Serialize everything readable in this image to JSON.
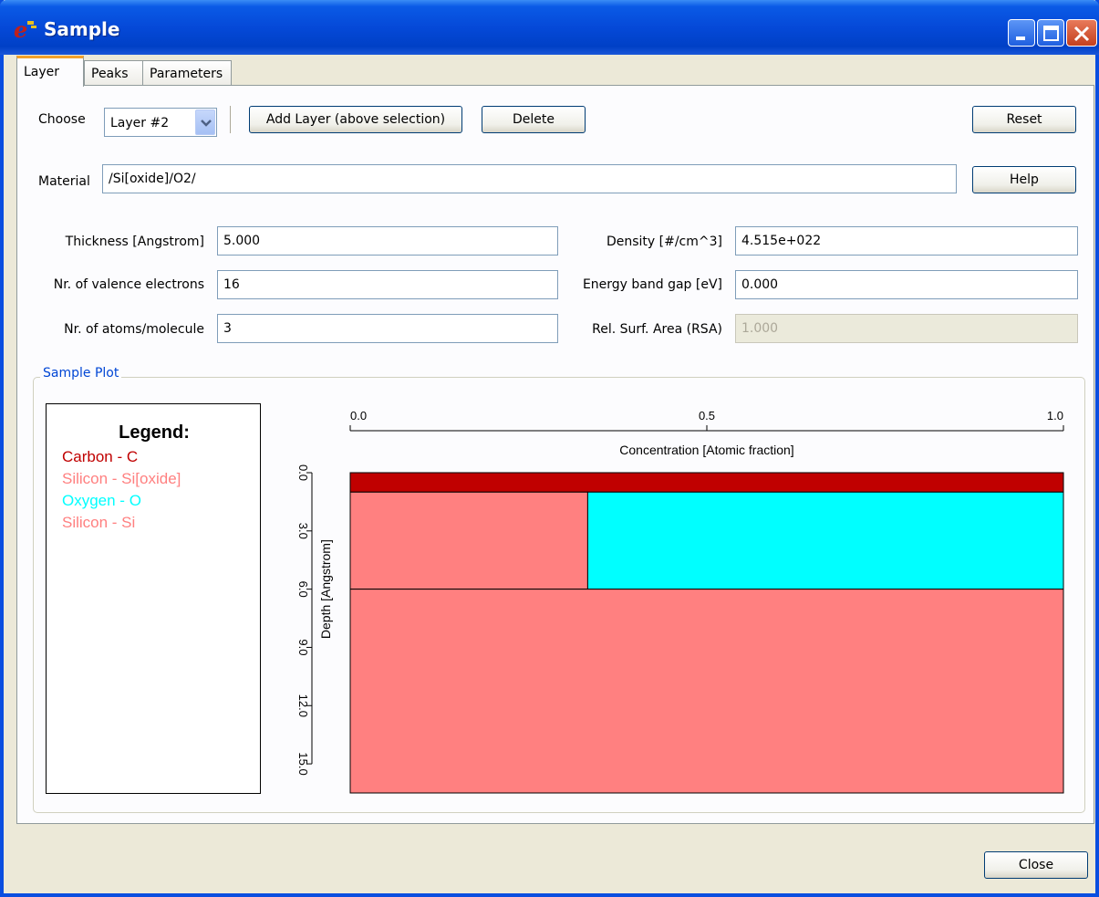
{
  "window": {
    "title": "Sample"
  },
  "tabs": [
    {
      "label": "Layer",
      "active": true
    },
    {
      "label": "Peaks",
      "active": false
    },
    {
      "label": "Parameters",
      "active": false
    }
  ],
  "layer": {
    "choose_label": "Choose",
    "layer_select_value": "Layer #2",
    "add_layer_label": "Add Layer (above selection)",
    "delete_label": "Delete",
    "reset_label": "Reset",
    "material_label": "Material",
    "material_value": "/Si[oxide]/O2/",
    "help_label": "Help"
  },
  "params": {
    "thickness_label": "Thickness [Angstrom]",
    "thickness_value": "5.000",
    "valence_label": "Nr. of valence electrons",
    "valence_value": "16",
    "atoms_label": "Nr. of atoms/molecule",
    "atoms_value": "3",
    "density_label": "Density [#/cm^3]",
    "density_value": "4.515e+022",
    "bandgap_label": "Energy band gap [eV]",
    "bandgap_value": "0.000",
    "rsa_label": "Rel. Surf. Area (RSA)",
    "rsa_value": "1.000"
  },
  "sample_plot": {
    "group_title": "Sample Plot",
    "legend": {
      "title": "Legend:",
      "items": [
        {
          "label": "Carbon - C",
          "color": "#c00000"
        },
        {
          "label": "Silicon - Si[oxide]",
          "color": "#ff8080"
        },
        {
          "label": "Oxygen - O",
          "color": "#00ffff"
        },
        {
          "label": "Silicon - Si",
          "color": "#ff8080"
        }
      ]
    }
  },
  "chart_data": {
    "type": "area",
    "xlabel": "Concentration [Atomic fraction]",
    "ylabel": "Depth [Angstrom]",
    "xlim": [
      0,
      1
    ],
    "ylim": [
      0,
      16.5
    ],
    "x_ticks": [
      "0.0",
      "0.5",
      "1.0"
    ],
    "y_ticks": [
      "0.0",
      "3.0",
      "6.0",
      "9.0",
      "12.0",
      "15.0"
    ],
    "layers": [
      {
        "name": "Carbon - C",
        "depth_from": 0.0,
        "depth_to": 1.0,
        "segments": [
          {
            "element": "Carbon - C",
            "x_from": 0.0,
            "x_to": 1.0,
            "color": "#c00000"
          }
        ]
      },
      {
        "name": "Si[oxide]/O2",
        "depth_from": 1.0,
        "depth_to": 6.0,
        "segments": [
          {
            "element": "Silicon - Si[oxide]",
            "x_from": 0.0,
            "x_to": 0.333,
            "color": "#ff8080"
          },
          {
            "element": "Oxygen - O",
            "x_from": 0.333,
            "x_to": 1.0,
            "color": "#00ffff"
          }
        ]
      },
      {
        "name": "Si",
        "depth_from": 6.0,
        "depth_to": 16.5,
        "segments": [
          {
            "element": "Silicon - Si",
            "x_from": 0.0,
            "x_to": 1.0,
            "color": "#ff8080"
          }
        ]
      }
    ]
  },
  "footer": {
    "close_label": "Close"
  }
}
